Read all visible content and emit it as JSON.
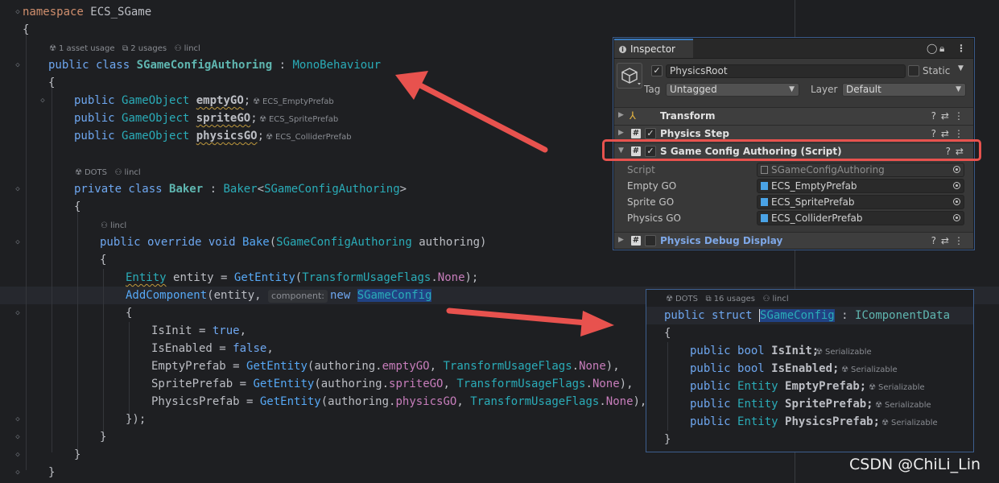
{
  "code": {
    "ns_kw": "namespace",
    "ns_name": "ECS_SGame",
    "hint_class": {
      "usage": "1 asset usage",
      "usages": "2 usages",
      "author": "lincl"
    },
    "class_kw": "public class",
    "class_name": "SGameConfigAuthoring",
    "class_base": "MonoBehaviour",
    "fields": [
      {
        "kw": "public",
        "type": "GameObject",
        "name": "emptyGO",
        "hint": "ECS_EmptyPrefab"
      },
      {
        "kw": "public",
        "type": "GameObject",
        "name": "spriteGO",
        "hint": "ECS_SpritePrefab"
      },
      {
        "kw": "public",
        "type": "GameObject",
        "name": "physicsGO",
        "hint": "ECS_ColliderPrefab"
      }
    ],
    "hint_baker": {
      "tag": "DOTS",
      "author": "lincl"
    },
    "baker_kw": "private class",
    "baker_name": "Baker",
    "baker_base": "Baker",
    "baker_generic": "SGameConfigAuthoring",
    "hint_bake": {
      "author": "lincl"
    },
    "bake_kw": "public override void",
    "bake_name": "Bake",
    "bake_param_type": "SGameConfigAuthoring",
    "bake_param": "authoring",
    "entity_type": "Entity",
    "entity_var": "entity",
    "get_entity": "GetEntity",
    "flags_type": "TransformUsageFlags",
    "flags_none": "None",
    "add_component": "AddComponent",
    "inlay_component": "component:",
    "new_kw": "new",
    "struct_name": "SGameConfig",
    "init_fields": [
      {
        "name": "IsInit",
        "value": "true",
        "type": "bool"
      },
      {
        "name": "IsEnabled",
        "value": "false",
        "type": "bool"
      }
    ],
    "prefab_fields": [
      {
        "name": "EmptyPrefab",
        "src": "emptyGO"
      },
      {
        "name": "SpritePrefab",
        "src": "spriteGO"
      },
      {
        "name": "PhysicsPrefab",
        "src": "physicsGO"
      }
    ],
    "authoring_var": "authoring"
  },
  "inspector": {
    "tab_label": "Inspector",
    "object_name": "PhysicsRoot",
    "static_label": "Static",
    "tag_label": "Tag",
    "tag_value": "Untagged",
    "layer_label": "Layer",
    "layer_value": "Default",
    "components": [
      {
        "name": "Transform"
      },
      {
        "name": "Physics Step"
      },
      {
        "name": "S Game Config Authoring (Script)"
      },
      {
        "name": "Physics Debug Display"
      }
    ],
    "properties": [
      {
        "label": "Script",
        "value": "SGameConfigAuthoring"
      },
      {
        "label": "Empty GO",
        "value": "ECS_EmptyPrefab"
      },
      {
        "label": "Sprite GO",
        "value": "ECS_SpritePrefab"
      },
      {
        "label": "Physics GO",
        "value": "ECS_ColliderPrefab"
      }
    ]
  },
  "popup": {
    "hint": {
      "tag": "DOTS",
      "usages": "16 usages",
      "author": "lincl"
    },
    "decl_kw": "public struct",
    "struct_name": "SGameConfig",
    "iface": "IComponentData",
    "serializable": "Serializable",
    "fields": [
      {
        "kw": "public",
        "type": "bool",
        "name": "IsInit;"
      },
      {
        "kw": "public",
        "type": "bool",
        "name": "IsEnabled;"
      },
      {
        "kw": "public",
        "type": "Entity",
        "name": "EmptyPrefab;"
      },
      {
        "kw": "public",
        "type": "Entity",
        "name": "SpritePrefab;"
      },
      {
        "kw": "public",
        "type": "Entity",
        "name": "PhysicsPrefab;"
      }
    ]
  },
  "watermark": "CSDN @ChiLi_Lin",
  "colors": {
    "arrow": "#e8524e",
    "accent": "#3a79bb"
  }
}
